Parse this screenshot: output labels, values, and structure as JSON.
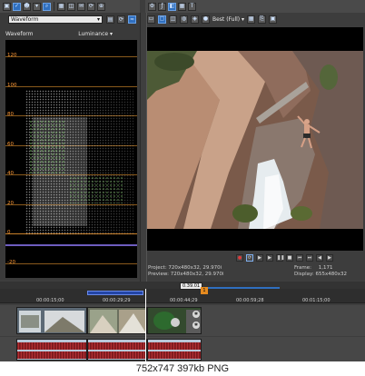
{
  "scopes": {
    "mode": "Waveform",
    "title": "Waveform",
    "channel": "Luminance",
    "y_labels": [
      "120",
      "100",
      "80",
      "60",
      "40",
      "20",
      "0",
      "-20"
    ]
  },
  "preview": {
    "quality": "Best (Full)",
    "project_label": "Project:",
    "project_value": "720x480x32, 29.970i",
    "preview_label": "Preview:",
    "preview_value": "720x480x32, 29.970i",
    "frame_label": "Frame:",
    "frame_value": "1,171",
    "display_label": "Display:",
    "display_value": "655x480x32"
  },
  "timeline": {
    "time_marks": [
      "00:00:15;00",
      "00:00:29;29",
      "00:00:44;29",
      "00:00:59;28",
      "00:01:15;00"
    ],
    "loop_start": "0.39.01",
    "marker": "1"
  },
  "caption": "752x747  397kb  PNG",
  "colors": {
    "graticule": "#8a5a1c",
    "graticule_label": "#ff9a38",
    "accent": "#2f6fbf",
    "audio_wave": "#b02f33"
  }
}
